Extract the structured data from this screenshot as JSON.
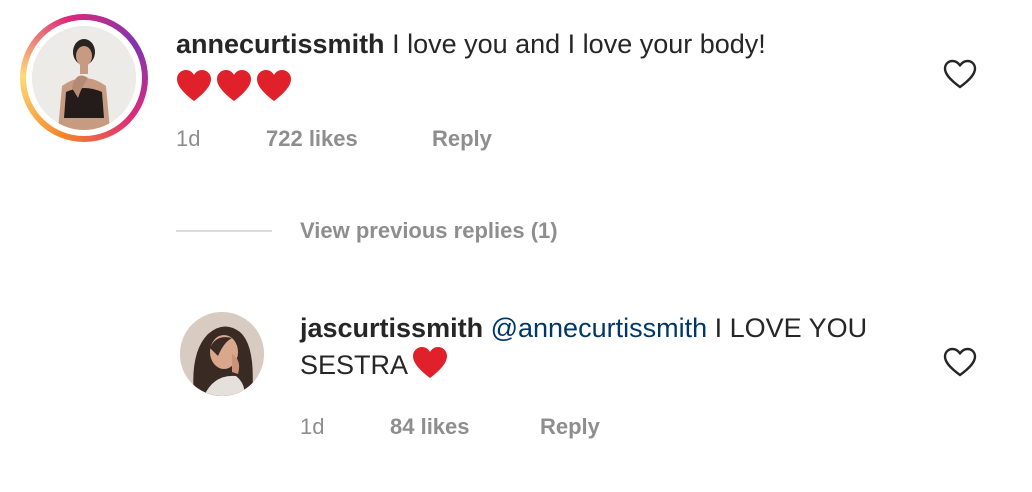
{
  "comment": {
    "username": "annecurtissmith",
    "text": " I love you and I love your body!",
    "emojis": [
      "red-heart",
      "red-heart",
      "red-heart"
    ],
    "time": "1d",
    "likes": "722 likes",
    "reply_label": "Reply",
    "like_icon": "heart-outline-icon"
  },
  "view_replies": {
    "label": "View previous replies (1)"
  },
  "reply": {
    "username": "jascurtissmith",
    "mention": "@annecurtissmith",
    "text": " I LOVE YOU SESTRA",
    "emoji": "red-heart",
    "time": "1d",
    "likes": "84 likes",
    "reply_label": "Reply",
    "like_icon": "heart-outline-icon"
  },
  "colors": {
    "username": "#262626",
    "mention": "#00376b",
    "meta": "#8e8e8e",
    "heart": "#e0202a"
  }
}
